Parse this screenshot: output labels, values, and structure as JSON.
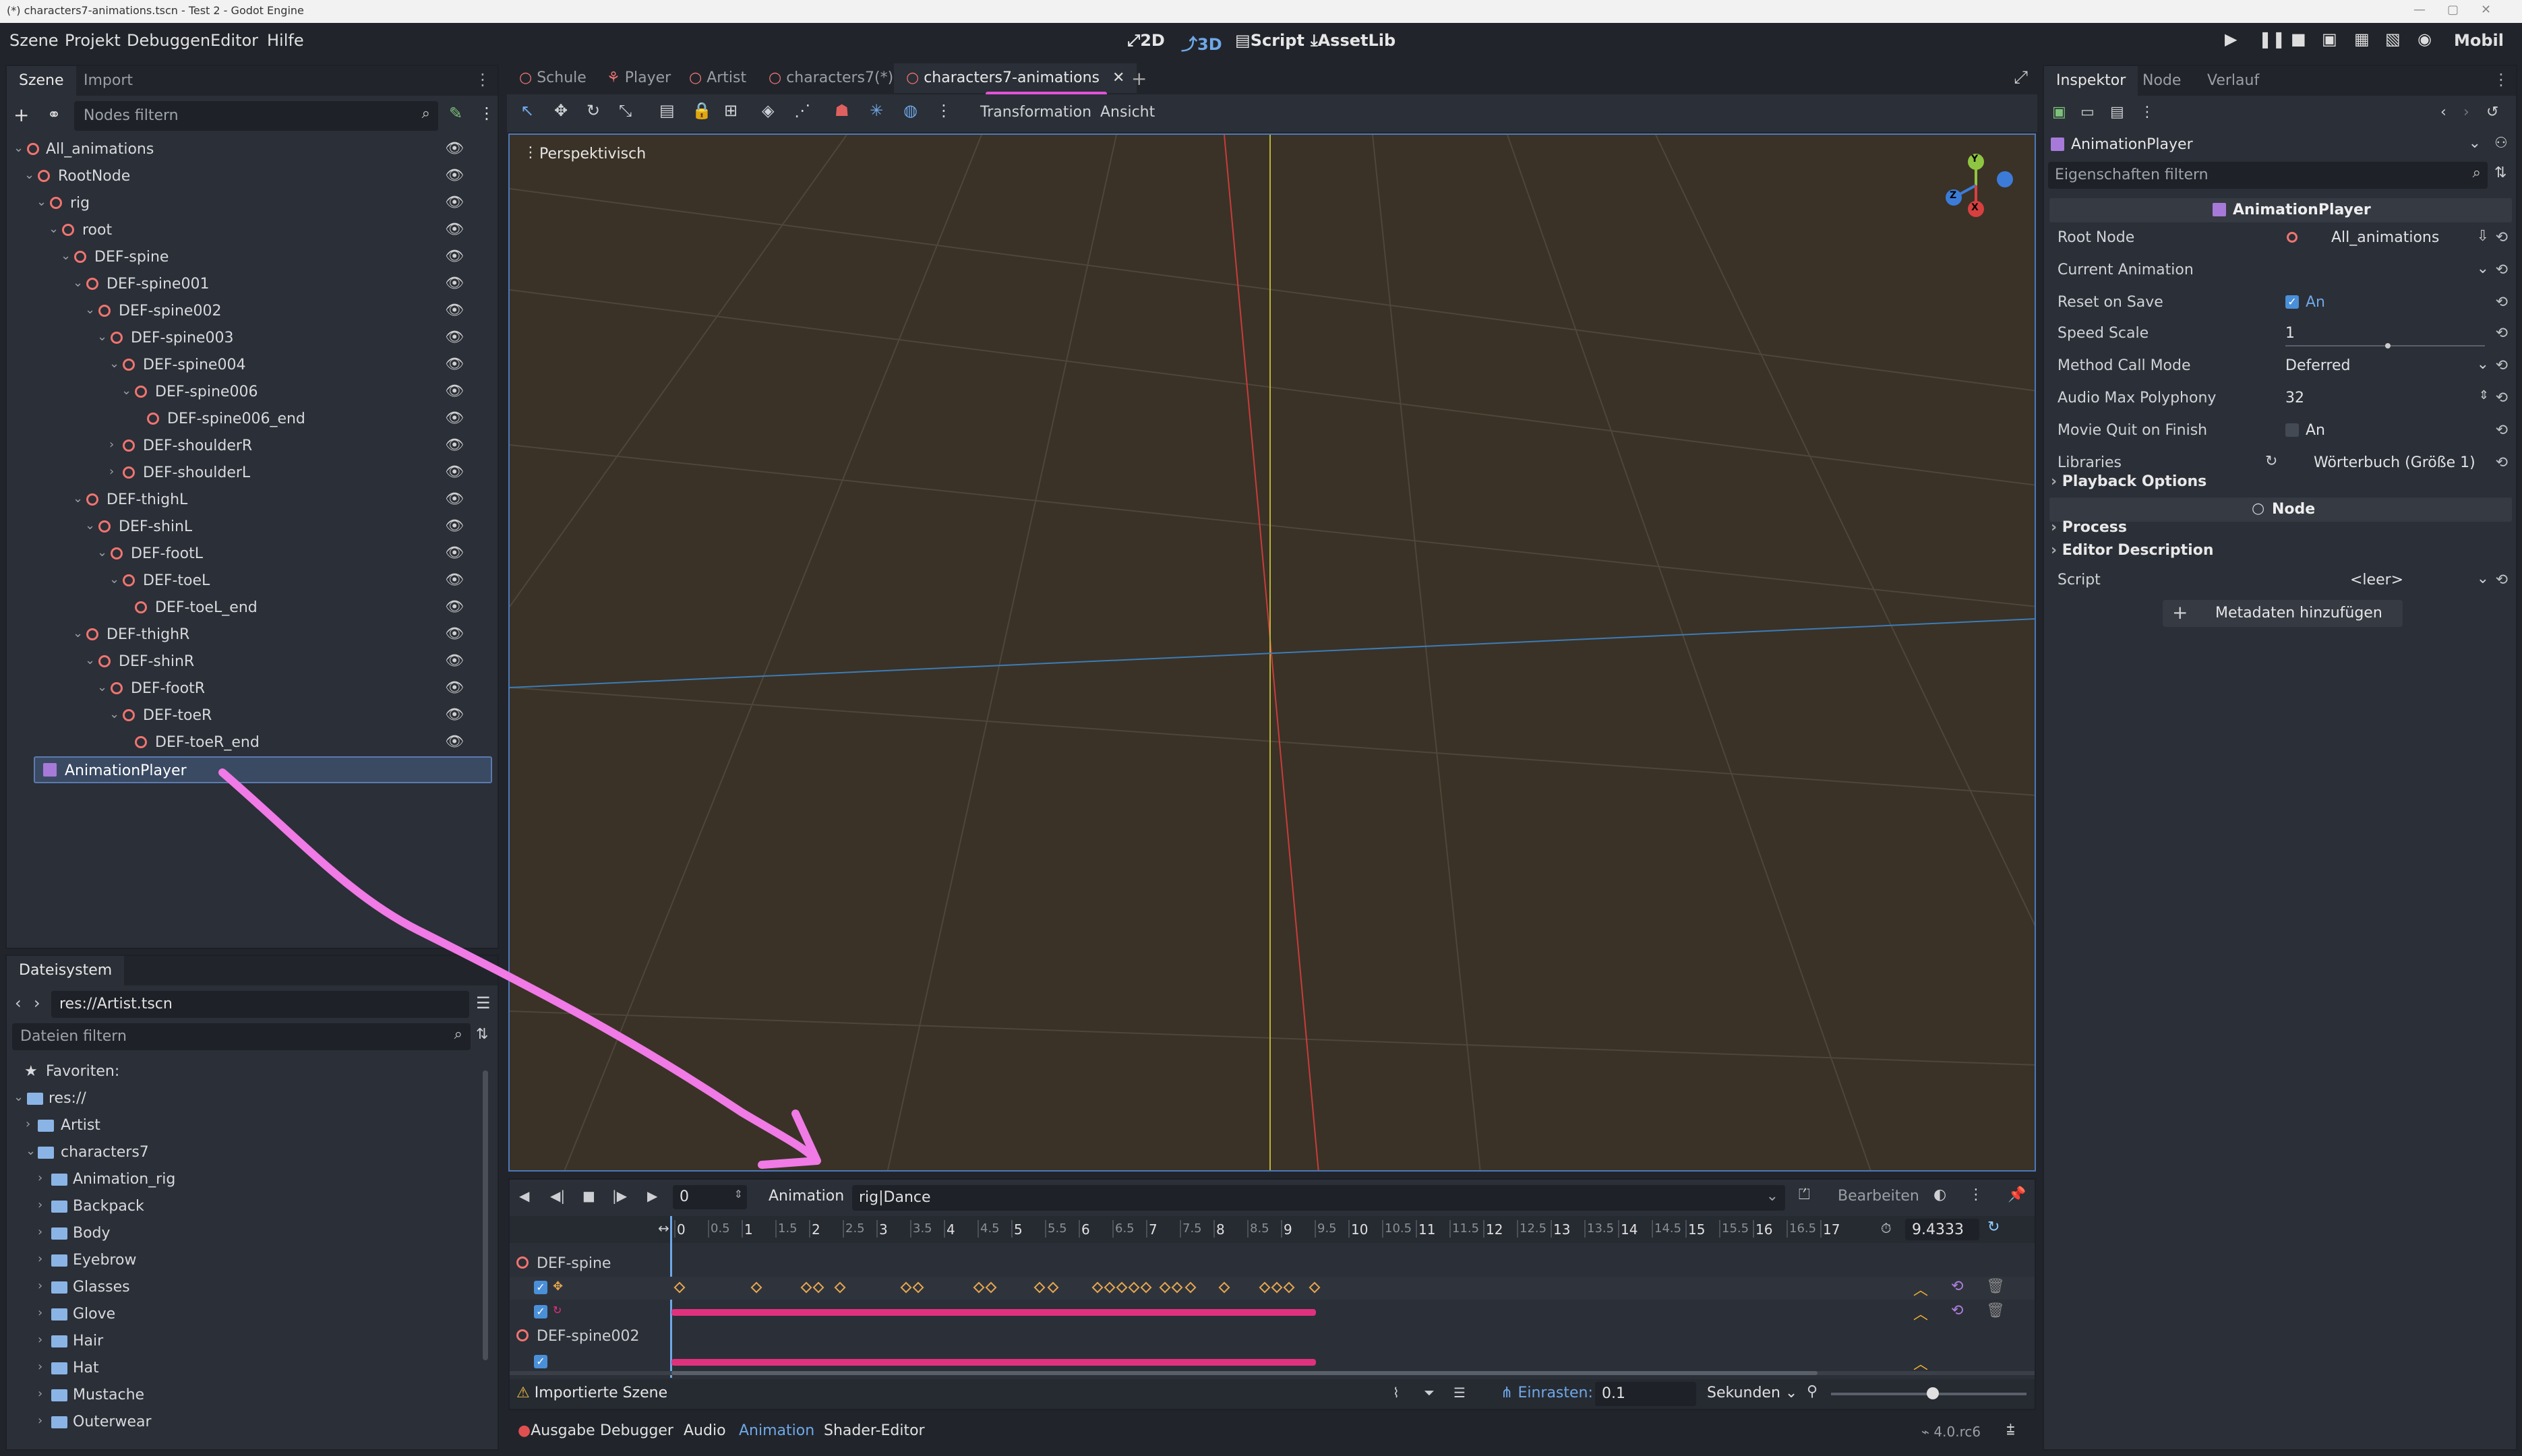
{
  "window": {
    "title": "(*) characters7-animations.tscn - Test 2 - Godot Engine"
  },
  "menu": {
    "items": [
      "Szene",
      "Projekt",
      "Debuggen",
      "Editor",
      "Hilfe"
    ]
  },
  "modes": {
    "m2d": "2D",
    "m3d": "3D",
    "script": "Script",
    "assetlib": "AssetLib"
  },
  "renderer": "Mobil",
  "scene_dock": {
    "tabs": [
      "Szene",
      "Import"
    ],
    "filter_placeholder": "Nodes filtern",
    "nodes": [
      "All_animations",
      "RootNode",
      "rig",
      "root",
      "DEF-spine",
      "DEF-spine001",
      "DEF-spine002",
      "DEF-spine003",
      "DEF-spine004",
      "DEF-spine006",
      "DEF-spine006_end",
      "DEF-shoulderR",
      "DEF-shoulderL",
      "DEF-thighL",
      "DEF-shinL",
      "DEF-footL",
      "DEF-toeL",
      "DEF-toeL_end",
      "DEF-thighR",
      "DEF-shinR",
      "DEF-footR",
      "DEF-toeR",
      "DEF-toeR_end",
      "AnimationPlayer"
    ]
  },
  "filesystem": {
    "tab": "Dateisystem",
    "path": "res://Artist.tscn",
    "filter_placeholder": "Dateien filtern",
    "favorites": "Favoriten:",
    "root": "res://",
    "items": [
      "Artist",
      "characters7",
      "Animation_rig",
      "Backpack",
      "Body",
      "Eyebrow",
      "Glasses",
      "Glove",
      "Hair",
      "Hat",
      "Mustache",
      "Outerwear"
    ]
  },
  "editor_tabs": [
    "Schule",
    "Player",
    "Artist",
    "characters7(*)",
    "characters7-animations"
  ],
  "viewport": {
    "toolbar_menus": [
      "Transformation",
      "Ansicht"
    ],
    "label": "Perspektivisch",
    "gizmo": {
      "y": "Y",
      "z": "Z",
      "x": "X"
    }
  },
  "animation": {
    "time_value": "0",
    "anim_label": "Animation",
    "current": "rig|Dance",
    "edit": "Bearbeiten",
    "ruler": [
      "0",
      "0.5",
      "1",
      "1.5",
      "2",
      "2.5",
      "3",
      "3.5",
      "4",
      "4.5",
      "5",
      "5.5",
      "6",
      "6.5",
      "7",
      "7.5",
      "8",
      "8.5",
      "9",
      "9.5",
      "10",
      "10.5",
      "11",
      "11.5",
      "12",
      "12.5",
      "13",
      "13.5",
      "14",
      "14.5",
      "15",
      "15.5",
      "16",
      "16.5",
      "17"
    ],
    "length": "9.4333",
    "tracks": [
      "DEF-spine",
      "DEF-spine002"
    ],
    "imported_scene": "Importierte Szene",
    "snap_label": "Einrasten:",
    "snap_value": "0.1",
    "unit": "Sekunden"
  },
  "bottom_tabs": [
    "Ausgabe",
    "Debugger",
    "Audio",
    "Animation",
    "Shader-Editor"
  ],
  "version": "4.0.rc6",
  "inspector": {
    "tabs": [
      "Inspektor",
      "Node",
      "Verlauf"
    ],
    "object": "AnimationPlayer",
    "filter_placeholder": "Eigenschaften filtern",
    "class_header": "AnimationPlayer",
    "props": [
      {
        "k": "Root Node",
        "v": "All_animations"
      },
      {
        "k": "Current Animation",
        "v": ""
      },
      {
        "k": "Reset on Save",
        "v": "An"
      },
      {
        "k": "Speed Scale",
        "v": "1"
      },
      {
        "k": "Method Call Mode",
        "v": "Deferred"
      },
      {
        "k": "Audio Max Polyphony",
        "v": "32"
      },
      {
        "k": "Movie Quit on Finish",
        "v": "An"
      },
      {
        "k": "Libraries",
        "v": "Wörterbuch (Größe 1)"
      }
    ],
    "playback": "Playback Options",
    "node_header": "Node",
    "process": "Process",
    "editor_desc": "Editor Description",
    "script_k": "Script",
    "script_v": "<leer>",
    "add_meta": "Metadaten hinzufügen"
  }
}
